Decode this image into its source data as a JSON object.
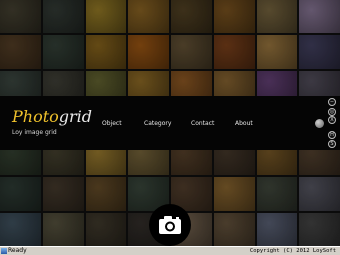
{
  "logo": {
    "title_part1": "Photo",
    "title_part2": "grid",
    "subtitle": "Loy image grid"
  },
  "nav": {
    "items": [
      "Object",
      "Category",
      "Contact",
      "About"
    ]
  },
  "side_controls": [
    "−",
    "◎",
    "X",
    "H",
    "S"
  ],
  "status": {
    "left": "Ready",
    "right": "Copyright (C) 2012 LoySoft"
  },
  "colors": {
    "logo_accent": "#f0c22c",
    "band": "#050505",
    "statusbar": "#d4d0c8"
  },
  "photo_tiles": [
    [
      "#3e3a2c",
      "#2e3530",
      "#866e22",
      "#7d5a20",
      "#4a3b20",
      "#6d4a1c",
      "#6a5a38",
      "#7a6a86"
    ],
    [
      "#4c3822",
      "#2f3a32",
      "#7a5a1a",
      "#8c4e12",
      "#5a4a30",
      "#6e3a18",
      "#8a6a38",
      "#3c3a56"
    ],
    [
      "#36403a",
      "#3a3a32",
      "#5a5a2c",
      "#806022",
      "#805020",
      "#7a5a2c",
      "#5a3a6a",
      "#4a4652"
    ],
    [
      "#3d3a2a",
      "#4a4024",
      "#6a5024",
      "#544024",
      "#2e2e2a",
      "#7a5a30",
      "#5a4a36",
      "#3a3a34"
    ],
    [
      "#2f3a2c",
      "#3e3a2a",
      "#8a6e2a",
      "#6a5a34",
      "#4e3a26",
      "#3e3226",
      "#6a4e22",
      "#4a3a2a"
    ],
    [
      "#2a3630",
      "#3e3428",
      "#5a4424",
      "#344036",
      "#4a3828",
      "#7a5a2a",
      "#3a4036",
      "#4e4e58"
    ],
    [
      "#3a4a56",
      "#4e4a38",
      "#3a3428",
      "#2e2a26",
      "#6a5a48",
      "#5a4a36",
      "#52586a",
      "#3e3e3e"
    ]
  ],
  "icons": {
    "camera": "camera-icon"
  }
}
